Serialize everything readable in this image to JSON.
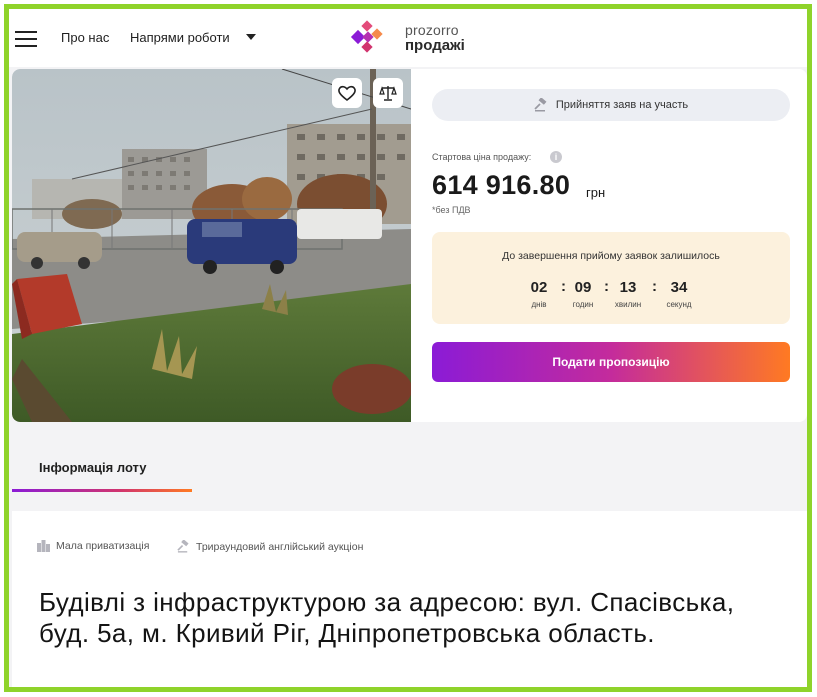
{
  "header": {
    "nav": {
      "about": "Про нас",
      "directions": "Напрями роботи"
    },
    "logo": {
      "top": "prozorro",
      "bottom": "продажі"
    }
  },
  "auction": {
    "status": "Прийняття заяв на участь",
    "start_price_label": "Стартова ціна продажу:",
    "price": "614 916.80",
    "currency": "грн",
    "vat_note": "*без ПДВ",
    "timer": {
      "title": "До завершення прийому заявок залишилось",
      "days": "02",
      "hours": "09",
      "minutes": "13",
      "seconds": "34",
      "days_label": "днів",
      "hours_label": "годин",
      "minutes_label": "хвилин",
      "seconds_label": "секунд"
    },
    "bid_button": "Подати пропозицію"
  },
  "tabs": {
    "lot_info": "Інформація лоту"
  },
  "lot": {
    "category": "Мала приватизація",
    "auction_type": "Трираундовий англійський аукціон",
    "title": "Будівлі з інфраструктурою за адресою: вул. Спасівська, буд. 5а, м. Кривий Ріг, Дніпропетровська область."
  },
  "colors": {
    "frame": "#8fd32a",
    "accent_start": "#8b1bd6",
    "accent_end": "#ff7a22",
    "timer_bg": "#fcf1dd"
  },
  "icons": [
    "menu-icon",
    "chevron-down-icon",
    "prozorro-logo-icon",
    "heart-icon",
    "scales-icon",
    "gavel-icon",
    "info-icon",
    "building-icon"
  ]
}
